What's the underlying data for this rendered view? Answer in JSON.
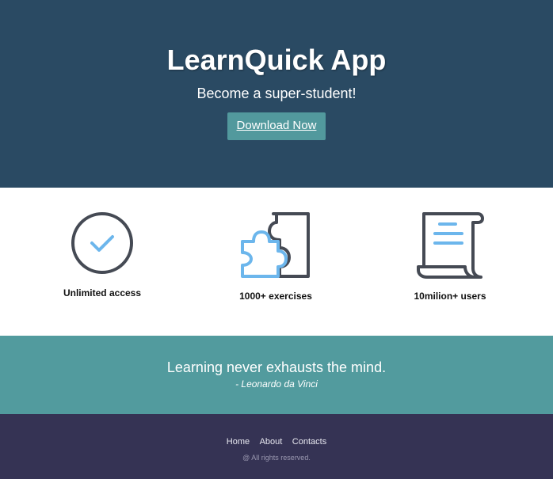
{
  "hero": {
    "title": "LearnQuick App",
    "subtitle": "Become a super-student!",
    "button_label": "Download Now"
  },
  "features": [
    {
      "label": "Unlimited access",
      "icon": "checkmark-circle-icon"
    },
    {
      "label": "1000+ exercises",
      "icon": "puzzle-icon"
    },
    {
      "label": "10milion+ users",
      "icon": "scroll-document-icon"
    }
  ],
  "quote": {
    "text": "Learning never exhausts the mind.",
    "author": "- Leonardo da Vinci"
  },
  "footer": {
    "links": [
      "Home",
      "About",
      "Contacts"
    ],
    "copyright": "@ All rights reserved."
  },
  "colors": {
    "hero_bg": "#2a4a63",
    "button_bg": "#52999d",
    "quote_bg": "#529b9e",
    "footer_bg": "#353354",
    "icon_dark": "#454a54",
    "icon_accent": "#6cb6ec"
  }
}
